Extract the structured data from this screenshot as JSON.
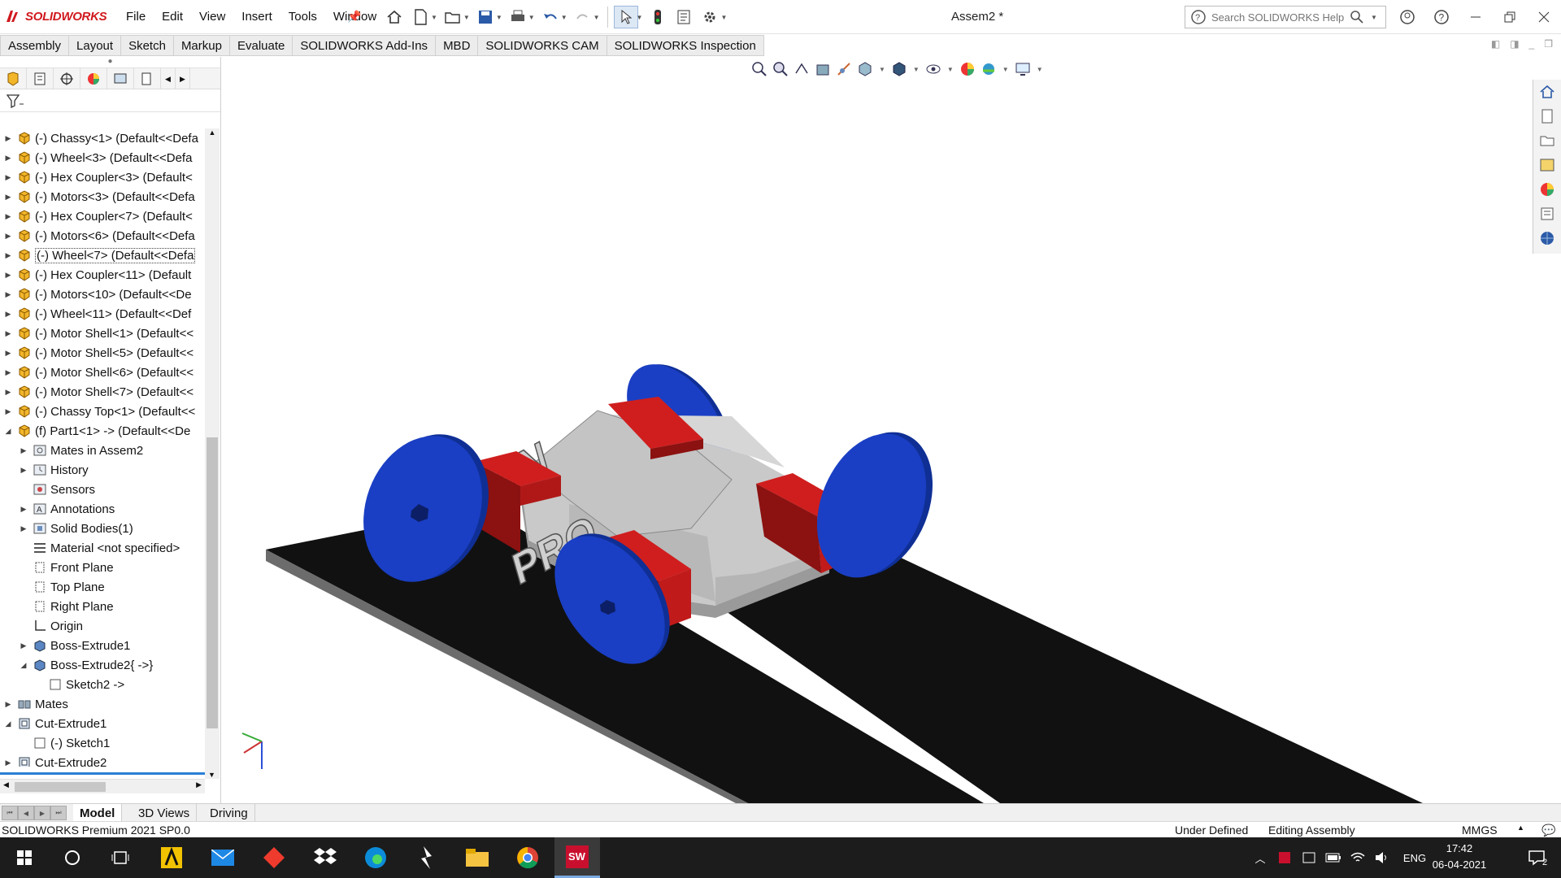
{
  "app": {
    "brand": "SOLIDWORKS",
    "document_title": "Assem2 *"
  },
  "menu": [
    "File",
    "Edit",
    "View",
    "Insert",
    "Tools",
    "Window"
  ],
  "help_search": {
    "placeholder": "Search SOLIDWORKS Help"
  },
  "command_tabs": [
    "Assembly",
    "Layout",
    "Sketch",
    "Markup",
    "Evaluate",
    "SOLIDWORKS Add-Ins",
    "MBD",
    "SOLIDWORKS CAM",
    "SOLIDWORKS Inspection"
  ],
  "tree": [
    {
      "label": "(-) Chassy<1> (Default<<Defa",
      "icon": "part-icon",
      "level": 0,
      "exp": "collapsed"
    },
    {
      "label": "(-) Wheel<3> (Default<<Defa",
      "icon": "part-icon",
      "level": 0,
      "exp": "collapsed"
    },
    {
      "label": "(-) Hex Coupler<3> (Default<",
      "icon": "part-icon",
      "level": 0,
      "exp": "collapsed"
    },
    {
      "label": "(-) Motors<3> (Default<<Defa",
      "icon": "part-icon",
      "level": 0,
      "exp": "collapsed"
    },
    {
      "label": "(-) Hex Coupler<7> (Default<",
      "icon": "part-icon",
      "level": 0,
      "exp": "collapsed"
    },
    {
      "label": "(-) Motors<6> (Default<<Defa",
      "icon": "part-icon",
      "level": 0,
      "exp": "collapsed"
    },
    {
      "label": "(-) Wheel<7> (Default<<Defa",
      "icon": "part-icon",
      "level": 0,
      "exp": "collapsed",
      "selected": true
    },
    {
      "label": "(-) Hex Coupler<11> (Default",
      "icon": "part-icon",
      "level": 0,
      "exp": "collapsed"
    },
    {
      "label": "(-) Motors<10> (Default<<De",
      "icon": "part-icon",
      "level": 0,
      "exp": "collapsed"
    },
    {
      "label": "(-) Wheel<11> (Default<<Def",
      "icon": "part-icon",
      "level": 0,
      "exp": "collapsed"
    },
    {
      "label": "(-) Motor Shell<1> (Default<<",
      "icon": "part-icon",
      "level": 0,
      "exp": "collapsed"
    },
    {
      "label": "(-) Motor Shell<5> (Default<<",
      "icon": "part-icon",
      "level": 0,
      "exp": "collapsed"
    },
    {
      "label": "(-) Motor Shell<6> (Default<<",
      "icon": "part-icon",
      "level": 0,
      "exp": "collapsed"
    },
    {
      "label": "(-) Motor Shell<7> (Default<<",
      "icon": "part-icon",
      "level": 0,
      "exp": "collapsed"
    },
    {
      "label": "(-) Chassy Top<1> (Default<<",
      "icon": "part-icon",
      "level": 0,
      "exp": "collapsed"
    },
    {
      "label": "(f) Part1<1> -> (Default<<De",
      "icon": "part-icon",
      "level": 0,
      "exp": "expanded"
    },
    {
      "label": "Mates in Assem2",
      "icon": "mates-folder-icon",
      "level": 1,
      "exp": "collapsed"
    },
    {
      "label": "History",
      "icon": "history-icon",
      "level": 1,
      "exp": "collapsed"
    },
    {
      "label": "Sensors",
      "icon": "sensors-icon",
      "level": 1,
      "exp": "none"
    },
    {
      "label": "Annotations",
      "icon": "annotations-icon",
      "level": 1,
      "exp": "collapsed"
    },
    {
      "label": "Solid Bodies(1)",
      "icon": "solid-bodies-icon",
      "level": 1,
      "exp": "collapsed"
    },
    {
      "label": "Material <not specified>",
      "icon": "material-icon",
      "level": 1,
      "exp": "none"
    },
    {
      "label": "Front Plane",
      "icon": "plane-icon",
      "level": 1,
      "exp": "none"
    },
    {
      "label": "Top Plane",
      "icon": "plane-icon",
      "level": 1,
      "exp": "none"
    },
    {
      "label": "Right Plane",
      "icon": "plane-icon",
      "level": 1,
      "exp": "none"
    },
    {
      "label": "Origin",
      "icon": "origin-icon",
      "level": 1,
      "exp": "none"
    },
    {
      "label": "Boss-Extrude1",
      "icon": "extrude-icon",
      "level": 1,
      "exp": "collapsed"
    },
    {
      "label": "Boss-Extrude2{ ->}",
      "icon": "extrude-icon",
      "level": 1,
      "exp": "expanded"
    },
    {
      "label": "Sketch2 ->",
      "icon": "sketch-icon",
      "level": 2,
      "exp": "none"
    },
    {
      "label": "Mates",
      "icon": "mates-icon",
      "level": 0,
      "exp": "collapsed"
    },
    {
      "label": "Cut-Extrude1",
      "icon": "cut-extrude-icon",
      "level": 0,
      "exp": "expanded"
    },
    {
      "label": "(-) Sketch1",
      "icon": "sketch-icon",
      "level": 1,
      "exp": "none"
    },
    {
      "label": "Cut-Extrude2",
      "icon": "cut-extrude-icon",
      "level": 0,
      "exp": "collapsed"
    }
  ],
  "model_text": {
    "line1": "MAN",
    "line2": "PRO"
  },
  "bottom_tabs": [
    "Model",
    "3D Views",
    "Driving"
  ],
  "status": {
    "version": "SOLIDWORKS Premium 2021 SP0.0",
    "state": "Under Defined",
    "mode": "Editing Assembly",
    "units": "MMGS"
  },
  "taskbar": {
    "lang": "ENG",
    "time": "17:42",
    "date": "06-04-2021",
    "notifications": "2"
  },
  "colors": {
    "wheel": "#1a3fc4",
    "motor_shell": "#c41818",
    "chassis": "#c9c9c9",
    "track": "#111111",
    "brand_red": "#d0191e"
  }
}
